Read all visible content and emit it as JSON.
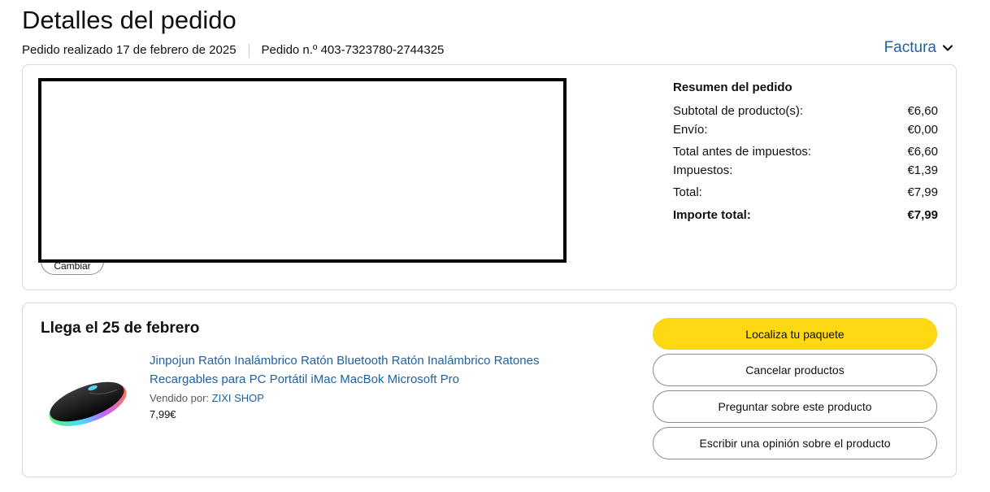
{
  "header": {
    "title": "Detalles del pedido",
    "order_placed": "Pedido realizado 17 de febrero de 2025",
    "order_number": "Pedido n.º 403-7323780-2744325",
    "invoice_label": "Factura"
  },
  "address": {
    "change_label": "Cambiar"
  },
  "summary": {
    "title": "Resumen del pedido",
    "rows": [
      {
        "label": "Subtotal de producto(s):",
        "value": "€6,60"
      },
      {
        "label": "Envío:",
        "value": "€0,00"
      },
      {
        "label": "Total antes de impuestos:",
        "value": "€6,60"
      },
      {
        "label": "Impuestos:",
        "value": "€1,39"
      },
      {
        "label": "Total:",
        "value": "€7,99"
      }
    ],
    "grand_total_label": "Importe total:",
    "grand_total_value": "€7,99"
  },
  "shipment": {
    "delivery_text": "Llega el 25 de febrero",
    "product_title": "Jinpojun Ratón Inalámbrico Ratón Bluetooth Ratón Inalámbrico Ratones Recargables para PC Portátil iMac MacBok Microsoft Pro",
    "sold_by_label": "Vendido por:",
    "seller_name": "ZIXI SHOP",
    "price": "7,99€",
    "actions": {
      "track": "Localiza tu paquete",
      "cancel": "Cancelar productos",
      "ask": "Preguntar sobre este producto",
      "review": "Escribir una opinión sobre el producto"
    }
  },
  "colors": {
    "link": "#2162a1",
    "primary_button": "#ffd814",
    "border": "#d5d9d9"
  }
}
